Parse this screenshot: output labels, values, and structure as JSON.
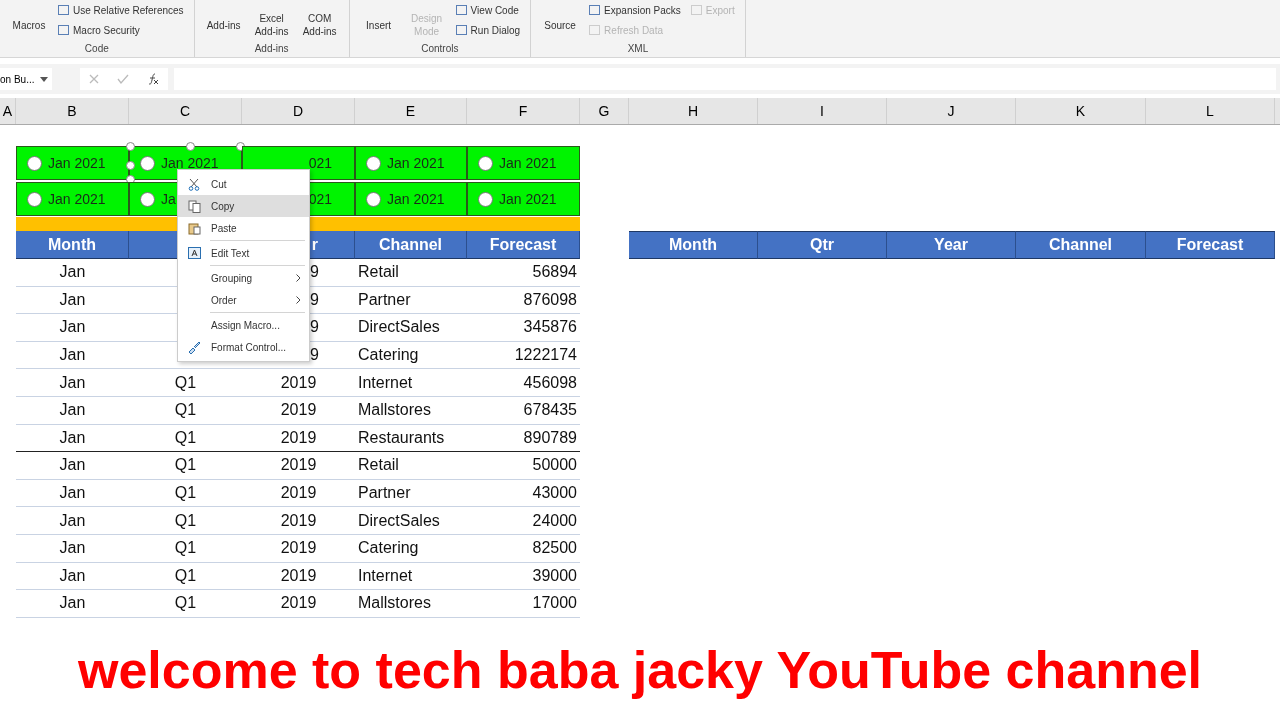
{
  "ribbon": {
    "groups": [
      {
        "label": "Code",
        "items": [
          {
            "label": "Macros",
            "kind": "large",
            "disabled": false
          },
          {
            "label": "Use Relative References",
            "kind": "small",
            "disabled": false
          },
          {
            "label": "Macro Security",
            "kind": "small",
            "disabled": false
          }
        ]
      },
      {
        "label": "Add-ins",
        "items": [
          {
            "label": "Add-ins",
            "kind": "large",
            "disabled": false
          },
          {
            "label": "Excel Add-ins",
            "kind": "large",
            "disabled": false
          },
          {
            "label": "COM Add-ins",
            "kind": "large",
            "disabled": false
          }
        ]
      },
      {
        "label": "Controls",
        "items": [
          {
            "label": "Insert",
            "kind": "large",
            "disabled": false
          },
          {
            "label": "Design Mode",
            "kind": "large",
            "disabled": true
          },
          {
            "label": "View Code",
            "kind": "small",
            "disabled": false
          },
          {
            "label": "Run Dialog",
            "kind": "small",
            "disabled": false
          }
        ]
      },
      {
        "label": "XML",
        "items": [
          {
            "label": "Source",
            "kind": "large",
            "disabled": false
          },
          {
            "label": "Expansion Packs",
            "kind": "small",
            "disabled": false
          },
          {
            "label": "Refresh Data",
            "kind": "small",
            "disabled": true
          },
          {
            "label": "Export",
            "kind": "small",
            "disabled": true
          }
        ]
      }
    ]
  },
  "name_box": "on Bu...",
  "columns": [
    "A",
    "B",
    "C",
    "D",
    "E",
    "F",
    "G",
    "H",
    "I",
    "J",
    "K",
    "L"
  ],
  "radio_rows": [
    [
      {
        "label": "Jan 2021",
        "selected": false,
        "clipped": false,
        "handles": false
      },
      {
        "label": "Jan 2021",
        "selected": false,
        "clipped": false,
        "handles": true
      },
      {
        "label": "021",
        "clipped": true,
        "handles": false
      },
      {
        "label": "Jan 2021",
        "selected": false,
        "clipped": false,
        "handles": false
      },
      {
        "label": "Jan 2021",
        "selected": false,
        "clipped": false,
        "handles": false
      }
    ],
    [
      {
        "label": "Jan 2021",
        "selected": false,
        "clipped": false,
        "handles": false
      },
      {
        "label": "Ja",
        "selected": false,
        "clipped": false,
        "handles": false
      },
      {
        "label": "021",
        "clipped": true,
        "handles": false
      },
      {
        "label": "Jan 2021",
        "selected": false,
        "clipped": false,
        "handles": false
      },
      {
        "label": "Jan 2021",
        "selected": false,
        "clipped": false,
        "handles": false
      }
    ]
  ],
  "left_table": {
    "header": {
      "month": "Month",
      "year": "r",
      "channel": "Channel",
      "forecast": "Forecast",
      "clipped": true
    },
    "rows": [
      {
        "month": "Jan",
        "year": "9",
        "channel": "Retail",
        "forecast": "56894",
        "clipped": true
      },
      {
        "month": "Jan",
        "year": "9",
        "channel": "Partner",
        "forecast": "876098",
        "clipped": true
      },
      {
        "month": "Jan",
        "year": "9",
        "channel": "DirectSales",
        "forecast": "345876",
        "clipped": true
      },
      {
        "month": "Jan",
        "year": "9",
        "channel": "Catering",
        "forecast": "1222174",
        "clipped": true
      },
      {
        "month": "Jan",
        "qtr": "Q1",
        "year": "2019",
        "channel": "Internet",
        "forecast": "456098",
        "clipped": false
      },
      {
        "month": "Jan",
        "qtr": "Q1",
        "year": "2019",
        "channel": "Mallstores",
        "forecast": "678435",
        "clipped": false
      },
      {
        "month": "Jan",
        "qtr": "Q1",
        "year": "2019",
        "channel": "Restaurants",
        "forecast": "890789",
        "clipped": false
      },
      {
        "month": "Jan",
        "qtr": "Q1",
        "year": "2019",
        "channel": "Retail",
        "forecast": "50000",
        "clipped": false
      },
      {
        "month": "Jan",
        "qtr": "Q1",
        "year": "2019",
        "channel": "Partner",
        "forecast": "43000",
        "clipped": false
      },
      {
        "month": "Jan",
        "qtr": "Q1",
        "year": "2019",
        "channel": "DirectSales",
        "forecast": "24000",
        "clipped": false
      },
      {
        "month": "Jan",
        "qtr": "Q1",
        "year": "2019",
        "channel": "Catering",
        "forecast": "82500",
        "clipped": false
      },
      {
        "month": "Jan",
        "qtr": "Q1",
        "year": "2019",
        "channel": "Internet",
        "forecast": "39000",
        "clipped": false
      },
      {
        "month": "Jan",
        "qtr": "Q1",
        "year": "2019",
        "channel": "Mallstores",
        "forecast": "17000",
        "clipped": false
      }
    ]
  },
  "right_table": {
    "header": [
      "Month",
      "Qtr",
      "Year",
      "Channel",
      "Forecast"
    ]
  },
  "context_menu": [
    {
      "label": "Cut",
      "kind": "cut",
      "selected": false,
      "submenu": false,
      "divider_after": false
    },
    {
      "label": "Copy",
      "kind": "copy",
      "selected": true,
      "submenu": false,
      "divider_after": false
    },
    {
      "label": "Paste",
      "kind": "paste",
      "selected": false,
      "submenu": false,
      "divider_after": true
    },
    {
      "label": "Edit Text",
      "kind": "text",
      "selected": false,
      "submenu": false,
      "divider_after": true
    },
    {
      "label": "Grouping",
      "kind": "plain",
      "selected": false,
      "submenu": true,
      "divider_after": false
    },
    {
      "label": "Order",
      "kind": "plain",
      "selected": false,
      "submenu": true,
      "divider_after": true
    },
    {
      "label": "Assign Macro...",
      "kind": "plain",
      "selected": false,
      "submenu": false,
      "divider_after": false
    },
    {
      "label": "Format Control...",
      "kind": "format",
      "selected": false,
      "submenu": false,
      "divider_after": false
    }
  ],
  "banner": "welcome to tech baba jacky YouTube channel"
}
